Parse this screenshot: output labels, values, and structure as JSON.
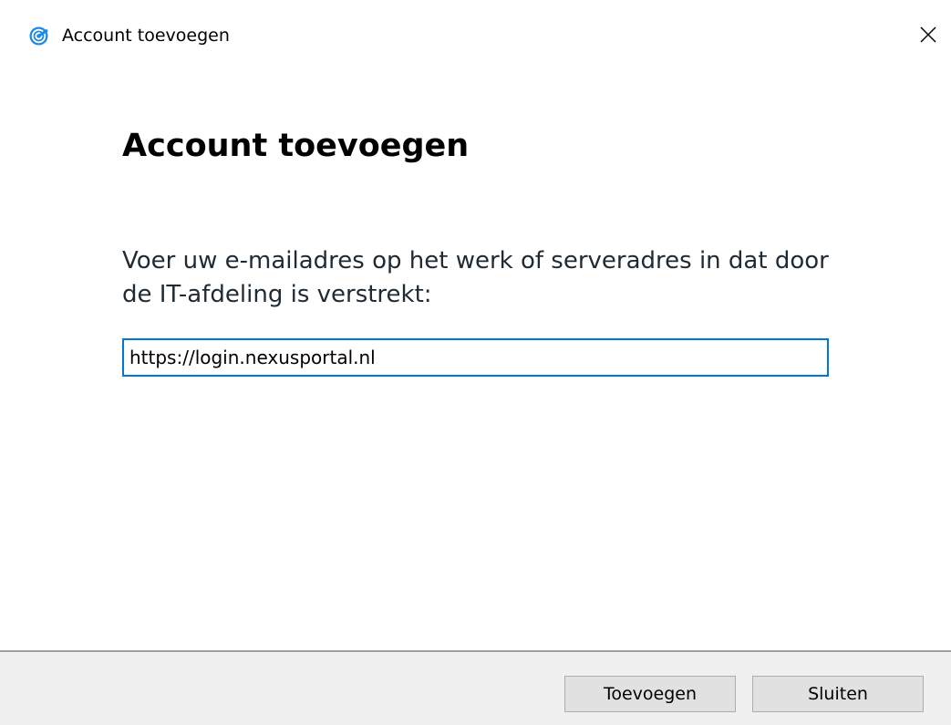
{
  "window": {
    "title": "Account toevoegen",
    "app_icon": "account-ring-icon",
    "close_icon": "close-icon"
  },
  "main": {
    "heading": "Account toevoegen",
    "prompt": "Voer uw e-mailadres op het werk of serveradres in dat door de IT-afdeling is verstrekt:",
    "input_value": "https://login.nexusportal.nl"
  },
  "footer": {
    "add_label": "Toevoegen",
    "close_label": "Sluiten"
  },
  "colors": {
    "accent": "#0078d7",
    "footer_bg": "#f0f0f0",
    "button_bg": "#e1e1e1"
  }
}
